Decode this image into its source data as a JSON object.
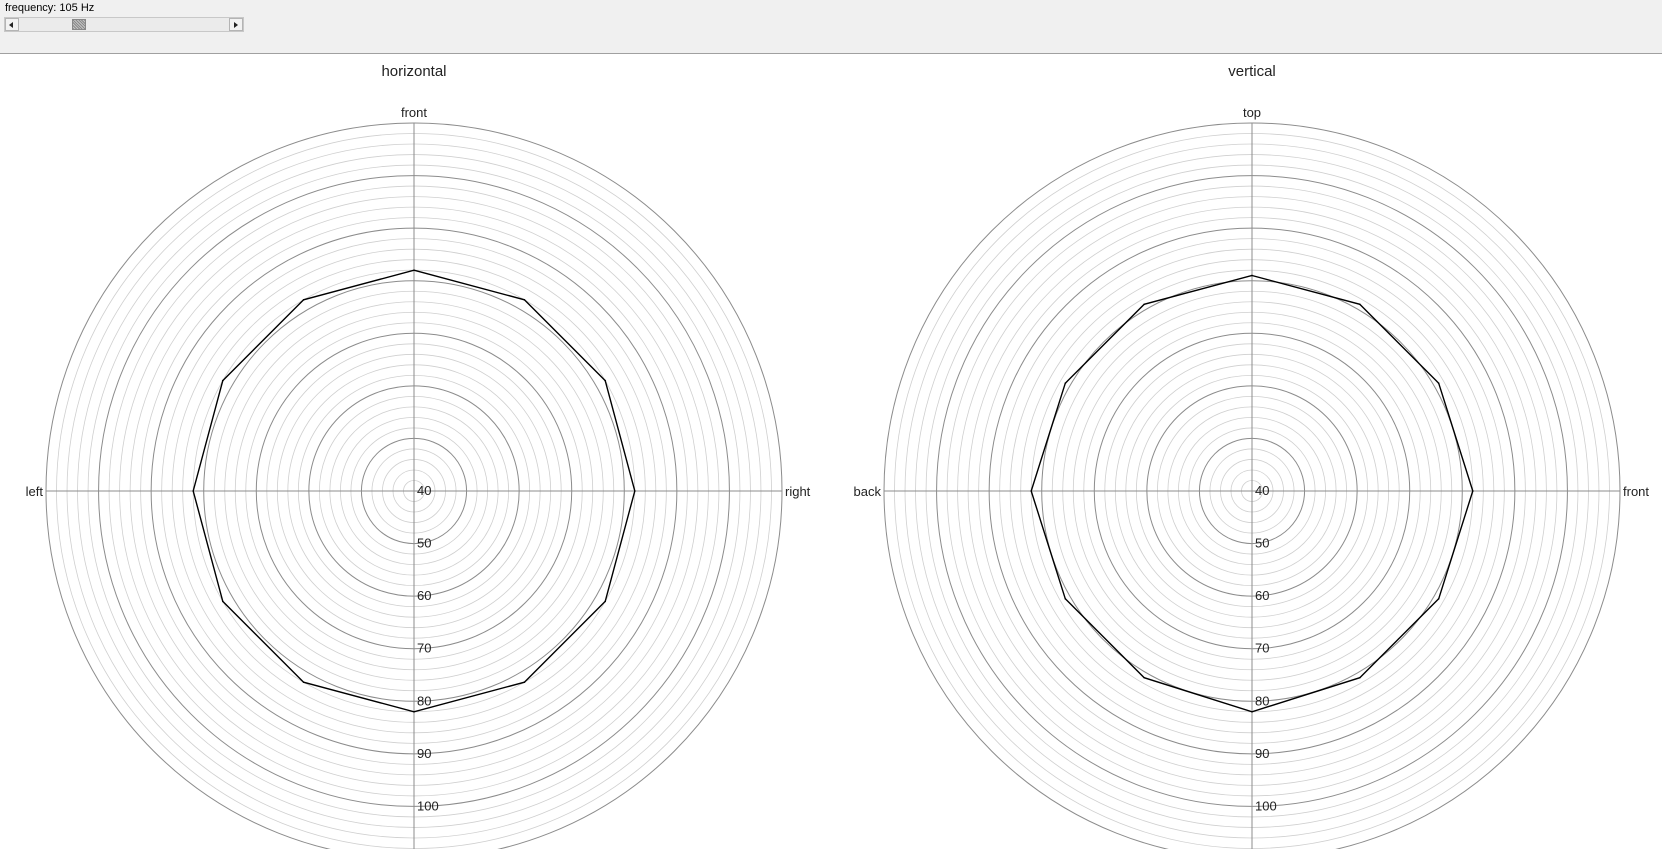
{
  "toolbar": {
    "frequency_label": "frequency: 105 Hz",
    "slider": {
      "value_fraction": 0.27
    }
  },
  "chart_data": [
    {
      "type": "radar",
      "title": "horizontal",
      "direction_labels": {
        "top": "front",
        "right": "right",
        "bottom": "",
        "left": "left"
      },
      "r_ticks": [
        40,
        50,
        60,
        70,
        80,
        90,
        100
      ],
      "r_range": [
        40,
        110
      ],
      "minor_step": 2,
      "angles_deg": [
        0,
        30,
        60,
        90,
        120,
        150,
        180,
        210,
        240,
        270,
        300,
        330
      ],
      "values": [
        82,
        82,
        82,
        82,
        82,
        82,
        82,
        82,
        82,
        82,
        82,
        82
      ]
    },
    {
      "type": "radar",
      "title": "vertical",
      "direction_labels": {
        "top": "top",
        "right": "front",
        "bottom": "",
        "left": "back"
      },
      "r_ticks": [
        40,
        50,
        60,
        70,
        80,
        90,
        100
      ],
      "r_range": [
        40,
        110
      ],
      "minor_step": 2,
      "angles_deg": [
        0,
        30,
        60,
        90,
        120,
        150,
        180,
        210,
        240,
        270,
        300,
        330
      ],
      "values": [
        81,
        81,
        81,
        82,
        81,
        81,
        82,
        81,
        81,
        82,
        81,
        81
      ]
    }
  ]
}
